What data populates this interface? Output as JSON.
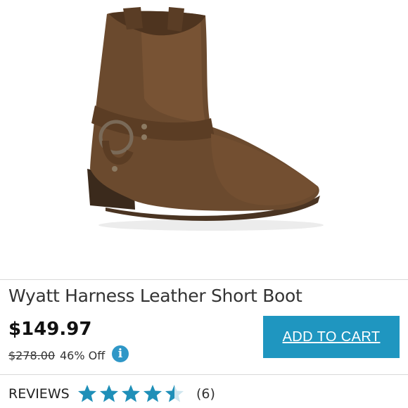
{
  "product": {
    "image_alt": "brown leather harness short boot",
    "title": "Wyatt Harness Leather Short Boot",
    "price": "$149.97",
    "original_price": "$278.00",
    "discount": "46% Off",
    "info_icon": "i"
  },
  "actions": {
    "add_to_cart_label": "ADD TO CART"
  },
  "reviews": {
    "label": "REVIEWS",
    "rating": 4.5,
    "max_rating": 5,
    "count_label": "(6)"
  },
  "colors": {
    "accent": "#1f96c0",
    "star": "#1f8fb8",
    "boot_leather": "#6b4a2e"
  }
}
